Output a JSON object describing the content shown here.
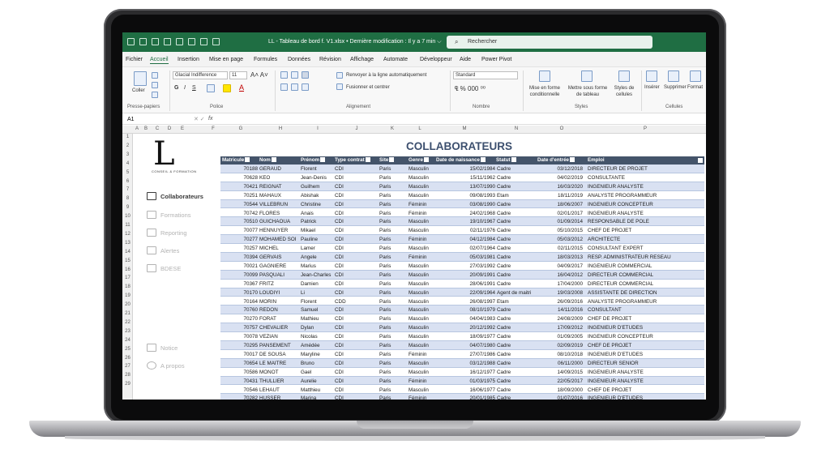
{
  "window": {
    "title": "LL - Tableau de bord f. V1.xlsx • Dernière modification : Il y a 7 min ⌵",
    "search_placeholder": "Rechercher"
  },
  "menu": [
    "Fichier",
    "Accueil",
    "Insertion",
    "Mise en page",
    "Formules",
    "Données",
    "Révision",
    "Affichage",
    "Automate",
    "Développeur",
    "Aide",
    "Power Pivot"
  ],
  "ribbon": {
    "paste": "Coller",
    "clipboard_group": "Presse-papiers",
    "font_name": "Glacial Indifference",
    "font_size": "11",
    "font_group": "Police",
    "wrap_text": "Renvoyer à la ligne automatiquement",
    "merge": "Fusionner et centrer",
    "alignment_group": "Alignement",
    "number_format": "Standard",
    "number_group": "Nombre",
    "cond_format": "Mise en forme conditionnelle",
    "table_format": "Mettre sous forme de tableau",
    "cell_styles": "Styles de cellules",
    "styles_group": "Styles",
    "insert": "Insérer",
    "delete": "Supprimer",
    "format": "Format",
    "cells_group": "Cellules"
  },
  "formula_bar": {
    "cell_ref": "A1",
    "fx": "fx"
  },
  "columns": [
    "A",
    "B",
    "C",
    "D",
    "E",
    "F",
    "G",
    "H",
    "I",
    "J",
    "K",
    "L",
    "M",
    "N",
    "O",
    "P"
  ],
  "rows": [
    "1",
    "2",
    "3",
    "4",
    "5",
    "6",
    "7",
    "8",
    "9",
    "10",
    "11",
    "12",
    "13",
    "14",
    "15",
    "16",
    "17",
    "18",
    "19",
    "20",
    "21",
    "22",
    "23",
    "24",
    "25",
    "26",
    "27",
    "28",
    "29"
  ],
  "logo": {
    "letter": "L",
    "subtitle": "CONSEIL & FORMATION"
  },
  "nav": {
    "collaborateurs": "Collaborateurs",
    "formations": "Formations",
    "reporting": "Reporting",
    "alertes": "Alertes",
    "bdese": "BDESE",
    "notice": "Notice",
    "apropos": "A propos"
  },
  "sheet_title": "COLLABORATEURS",
  "table": {
    "headers": [
      "Matricule",
      "Nom",
      "Prénom",
      "Type contrat",
      "Site",
      "Genre",
      "Date de naissance",
      "Statut",
      "Date d'entrée",
      "Emploi"
    ],
    "rows": [
      [
        "70188",
        "GERAUD",
        "Florent",
        "CDI",
        "Paris",
        "Masculin",
        "15/02/1984",
        "Cadre",
        "03/12/2018",
        "DIRECTEUR DE PROJET"
      ],
      [
        "70628",
        "KEO",
        "Jean-Denis",
        "CDI",
        "Paris",
        "Masculin",
        "15/11/1962",
        "Cadre",
        "04/02/2019",
        "CONSULTANTE"
      ],
      [
        "70421",
        "REIGNAT",
        "Guilhem",
        "CDI",
        "Paris",
        "Masculin",
        "13/07/1990",
        "Cadre",
        "16/03/2020",
        "INGENIEUR ANALYSTE"
      ],
      [
        "70251",
        "MAHAUX",
        "Abishak",
        "CDI",
        "Paris",
        "Masculin",
        "09/08/1993",
        "Etam",
        "18/11/2019",
        "ANALYSTE PROGRAMMEUR"
      ],
      [
        "70544",
        "VILLEBRUN",
        "Christine",
        "CDI",
        "Paris",
        "Féminin",
        "03/08/1990",
        "Cadre",
        "18/06/2007",
        "INGENIEUR CONCEPTEUR"
      ],
      [
        "70742",
        "FLORES",
        "Anais",
        "CDI",
        "Paris",
        "Féminin",
        "24/02/1968",
        "Cadre",
        "02/01/2017",
        "INGENIEUR ANALYSTE"
      ],
      [
        "70510",
        "GUICHAOUA",
        "Patrick",
        "CDI",
        "Paris",
        "Masculin",
        "19/10/1967",
        "Cadre",
        "01/09/2014",
        "RESPONSABLE DE POLE"
      ],
      [
        "70077",
        "HENNUYER",
        "Mikael",
        "CDI",
        "Paris",
        "Masculin",
        "02/11/1976",
        "Cadre",
        "05/10/2015",
        "CHEF DE PROJET"
      ],
      [
        "70277",
        "MOHAMED SOI",
        "Pauline",
        "CDI",
        "Paris",
        "Féminin",
        "04/12/1984",
        "Cadre",
        "05/03/2012",
        "ARCHITECTE"
      ],
      [
        "70257",
        "MICHEL",
        "Lamer",
        "CDI",
        "Paris",
        "Masculin",
        "02/07/1964",
        "Cadre",
        "02/11/2015",
        "CONSULTANT EXPERT"
      ],
      [
        "70394",
        "GERVAIS",
        "Angele",
        "CDI",
        "Paris",
        "Féminin",
        "05/03/1981",
        "Cadre",
        "18/03/2013",
        "RESP. ADMINISTRATEUR RESEAU"
      ],
      [
        "70021",
        "GAGNIERE",
        "Marius",
        "CDI",
        "Paris",
        "Masculin",
        "27/03/1992",
        "Cadre",
        "04/09/2017",
        "INGENIEUR COMMERCIAL"
      ],
      [
        "70099",
        "PASQUALI",
        "Jean-Charles",
        "CDI",
        "Paris",
        "Masculin",
        "20/09/1991",
        "Cadre",
        "16/04/2012",
        "DIRECTEUR COMMERCIAL"
      ],
      [
        "70367",
        "FRITZ",
        "Damien",
        "CDI",
        "Paris",
        "Masculin",
        "28/06/1991",
        "Cadre",
        "17/04/2000",
        "DIRECTEUR COMMERCIAL"
      ],
      [
        "70170",
        "LOUDIYI",
        "Li",
        "CDI",
        "Paris",
        "Masculin",
        "22/09/1964",
        "Agent de maitri",
        "19/03/2008",
        "ASSISTANTE DE DIRECTION"
      ],
      [
        "70164",
        "MORIN",
        "Florent",
        "CDD",
        "Paris",
        "Masculin",
        "26/08/1997",
        "Etam",
        "26/09/2016",
        "ANALYSTE PROGRAMMEUR"
      ],
      [
        "70760",
        "REDON",
        "Samuel",
        "CDI",
        "Paris",
        "Masculin",
        "08/10/1979",
        "Cadre",
        "14/11/2016",
        "CONSULTANT"
      ],
      [
        "70270",
        "FORAT",
        "Mathieu",
        "CDI",
        "Paris",
        "Masculin",
        "04/04/1983",
        "Cadre",
        "24/08/2009",
        "CHEF DE PROJET"
      ],
      [
        "70757",
        "CHEVALIER",
        "Dylan",
        "CDI",
        "Paris",
        "Masculin",
        "20/12/1992",
        "Cadre",
        "17/09/2012",
        "INGENIEUR D'ETUDES"
      ],
      [
        "70078",
        "VEZIAN",
        "Nicolas",
        "CDI",
        "Paris",
        "Masculin",
        "18/09/1977",
        "Cadre",
        "01/09/2005",
        "INGENIEUR CONCEPTEUR"
      ],
      [
        "70295",
        "PANSEMENT",
        "Amédée",
        "CDI",
        "Paris",
        "Masculin",
        "04/07/1980",
        "Cadre",
        "02/09/2019",
        "CHEF DE PROJET"
      ],
      [
        "70017",
        "DE SOUSA",
        "Maryline",
        "CDI",
        "Paris",
        "Féminin",
        "27/07/1986",
        "Cadre",
        "08/10/2018",
        "INGENIEUR D'ETUDES"
      ],
      [
        "70654",
        "LE MAITRE",
        "Bruno",
        "CDI",
        "Paris",
        "Masculin",
        "03/12/1988",
        "Cadre",
        "06/11/2000",
        "DIRECTEUR SENIOR"
      ],
      [
        "70586",
        "MONOT",
        "Gael",
        "CDI",
        "Paris",
        "Masculin",
        "16/12/1977",
        "Cadre",
        "14/09/2015",
        "INGENIEUR ANALYSTE"
      ],
      [
        "70431",
        "THULLIER",
        "Aurelie",
        "CDI",
        "Paris",
        "Féminin",
        "01/03/1975",
        "Cadre",
        "22/05/2017",
        "INGENIEUR ANALYSTE"
      ],
      [
        "70546",
        "LEHAUT",
        "Matthieu",
        "CDI",
        "Paris",
        "Masculin",
        "16/06/1977",
        "Cadre",
        "18/09/2000",
        "CHEF DE PROJET"
      ],
      [
        "70282",
        "HUSSER",
        "Marina",
        "CDI",
        "Paris",
        "Féminin",
        "20/01/1985",
        "Cadre",
        "01/07/2016",
        "INGENIEUR D'ETUDES"
      ]
    ]
  },
  "colors": {
    "excel_green": "#1f6e43",
    "header_blue": "#44546a",
    "band_blue": "#d9e1f2",
    "title_blue": "#3c4f6e"
  }
}
